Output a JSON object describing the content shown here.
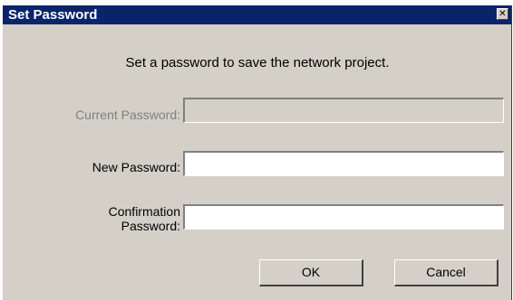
{
  "window": {
    "title": "Set Password",
    "close_glyph": "✕",
    "close_icon": "close-icon"
  },
  "message": "Set a password to save the network project.",
  "fields": {
    "current": {
      "label": "Current Password:",
      "value": "",
      "enabled": false
    },
    "new": {
      "label": "New Password:",
      "value": "",
      "enabled": true
    },
    "confirm": {
      "label_line1": "Confirmation",
      "label_line2": "Password:",
      "value": "",
      "enabled": true
    }
  },
  "buttons": {
    "ok": "OK",
    "cancel": "Cancel"
  },
  "colors": {
    "titlebar": "#0a246a",
    "dialog_bg": "#d4d0c8",
    "disabled_text": "#808080"
  }
}
